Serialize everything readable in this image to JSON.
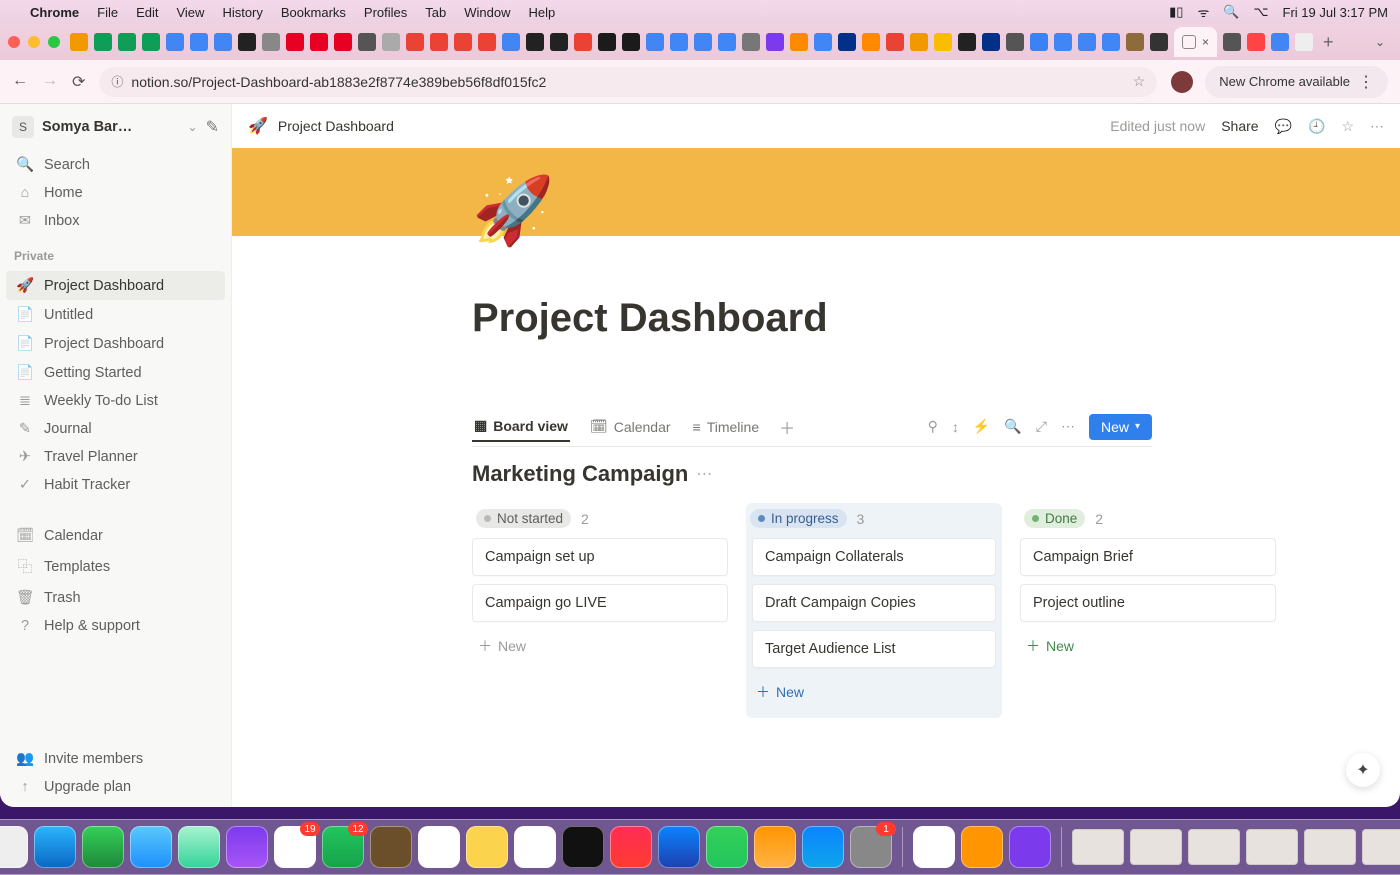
{
  "mac_menu": {
    "app": "Chrome",
    "items": [
      "File",
      "Edit",
      "View",
      "History",
      "Bookmarks",
      "Profiles",
      "Tab",
      "Window",
      "Help"
    ],
    "clock": "Fri 19 Jul  3:17 PM"
  },
  "browser": {
    "url": "notion.so/Project-Dashboard-ab1883e2f8774e389beb56f8df015fc2",
    "active_tab_close": "×",
    "new_chrome_label": "New Chrome available",
    "tabs_chevron": "⌄"
  },
  "notion": {
    "edit_status": "Edited just now",
    "share_label": "Share",
    "breadcrumb": {
      "emoji": "🚀",
      "title": "Project Dashboard"
    }
  },
  "sidebar": {
    "workspace_initial": "S",
    "workspace_name": "Somya Bar…",
    "top": [
      {
        "icon": "🔍",
        "label": "Search"
      },
      {
        "icon": "⌂",
        "label": "Home"
      },
      {
        "icon": "✉︎",
        "label": "Inbox"
      }
    ],
    "section_label": "Private",
    "pages": [
      {
        "icon": "🚀",
        "label": "Project Dashboard",
        "active": true
      },
      {
        "icon": "📄",
        "label": "Untitled"
      },
      {
        "icon": "📄",
        "label": "Project Dashboard"
      },
      {
        "icon": "📄",
        "label": "Getting Started"
      },
      {
        "icon": "≣",
        "label": "Weekly To-do List"
      },
      {
        "icon": "✎",
        "label": "Journal"
      },
      {
        "icon": "✈︎",
        "label": "Travel Planner"
      },
      {
        "icon": "✓",
        "label": "Habit Tracker"
      }
    ],
    "utility": [
      {
        "icon": "🗓",
        "label": "Calendar"
      },
      {
        "icon": "⿻",
        "label": "Templates"
      },
      {
        "icon": "🗑",
        "label": "Trash"
      },
      {
        "icon": "?",
        "label": "Help & support"
      }
    ],
    "footer": [
      {
        "icon": "👥",
        "label": "Invite members"
      },
      {
        "icon": "↑",
        "label": "Upgrade plan"
      }
    ]
  },
  "page": {
    "emoji": "🚀",
    "title": "Project Dashboard"
  },
  "database": {
    "views": [
      {
        "icon": "▦",
        "label": "Board view",
        "active": true
      },
      {
        "icon": "🗓",
        "label": "Calendar"
      },
      {
        "icon": "≡",
        "label": "Timeline"
      }
    ],
    "add_view_icon": "＋",
    "action_icons": [
      "⚲",
      "↕",
      "⚡",
      "🔍",
      "⤢",
      "⋯"
    ],
    "new_button": "New",
    "title": "Marketing Campaign",
    "columns": [
      {
        "key": "not_started",
        "pill_class": "pill-notstarted",
        "status": "Not started",
        "count": "2",
        "cards": [
          "Campaign set up",
          "Campaign go LIVE"
        ],
        "new_label": "New"
      },
      {
        "key": "in_progress",
        "pill_class": "pill-inprog",
        "col_extra": "inprog",
        "status": "In progress",
        "count": "3",
        "cards": [
          "Campaign Collaterals",
          "Draft Campaign Copies",
          "Target Audience List"
        ],
        "new_label": "New"
      },
      {
        "key": "done",
        "pill_class": "pill-done",
        "col_extra": "done",
        "status": "Done",
        "count": "2",
        "cards": [
          "Campaign Brief",
          "Project outline"
        ],
        "new_label": "New"
      }
    ]
  }
}
